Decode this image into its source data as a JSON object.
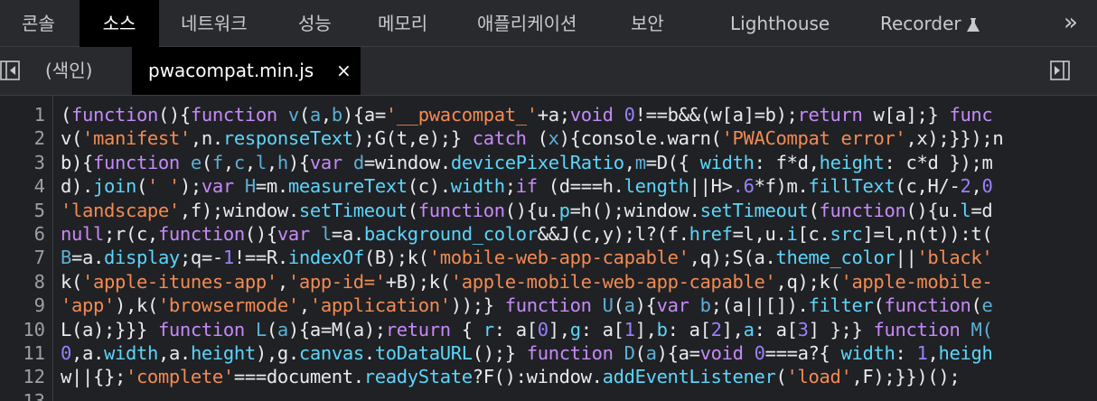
{
  "top_tabs": [
    {
      "label": "콘솔",
      "active": false
    },
    {
      "label": "소스",
      "active": true
    },
    {
      "label": "네트워크",
      "active": false
    },
    {
      "label": "성능",
      "active": false
    },
    {
      "label": "메모리",
      "active": false
    },
    {
      "label": "애플리케이션",
      "active": false
    },
    {
      "label": "보안",
      "active": false
    },
    {
      "label": "Lighthouse",
      "active": false
    },
    {
      "label": "Recorder",
      "active": false
    }
  ],
  "more_label": "»",
  "file_tabs": {
    "index_label": "(색인)",
    "file_label": "pwacompat.min.js",
    "close_label": "×"
  },
  "line_numbers": [
    "1",
    "2",
    "3",
    "4",
    "5",
    "6",
    "7",
    "8",
    "9",
    "10",
    "11",
    "12",
    "13"
  ],
  "code_lines": [
    [
      [
        "p",
        "("
      ],
      [
        "k",
        "function"
      ],
      [
        "p",
        "(){"
      ],
      [
        "k",
        "function"
      ],
      [
        "p",
        " "
      ],
      [
        "v",
        "v"
      ],
      [
        "p",
        "("
      ],
      [
        "v",
        "a"
      ],
      [
        "p",
        ","
      ],
      [
        "v",
        "b"
      ],
      [
        "p",
        "){a="
      ],
      [
        "s",
        "'__pwacompat_'"
      ],
      [
        "p",
        "+a;"
      ],
      [
        "k",
        "void"
      ],
      [
        "p",
        " "
      ],
      [
        "n",
        "0"
      ],
      [
        "p",
        "!==b&&(w[a]=b);"
      ],
      [
        "k",
        "return"
      ],
      [
        "p",
        " w[a];} "
      ],
      [
        "k",
        "func"
      ]
    ],
    [
      [
        "p",
        "v("
      ],
      [
        "s",
        "'manifest'"
      ],
      [
        "p",
        ",n."
      ],
      [
        "c",
        "responseText"
      ],
      [
        "p",
        ");G(t,e);} "
      ],
      [
        "k",
        "catch"
      ],
      [
        "p",
        " ("
      ],
      [
        "v",
        "x"
      ],
      [
        "p",
        "){console.warn("
      ],
      [
        "s",
        "'PWACompat error'"
      ],
      [
        "p",
        ",x);}});n"
      ]
    ],
    [
      [
        "p",
        "b){"
      ],
      [
        "k",
        "function"
      ],
      [
        "p",
        " "
      ],
      [
        "v",
        "e"
      ],
      [
        "p",
        "("
      ],
      [
        "v",
        "f"
      ],
      [
        "p",
        ","
      ],
      [
        "v",
        "c"
      ],
      [
        "p",
        ","
      ],
      [
        "v",
        "l"
      ],
      [
        "p",
        ","
      ],
      [
        "v",
        "h"
      ],
      [
        "p",
        "){"
      ],
      [
        "k",
        "var"
      ],
      [
        "p",
        " "
      ],
      [
        "v",
        "d"
      ],
      [
        "p",
        "=window."
      ],
      [
        "c",
        "devicePixelRatio"
      ],
      [
        "p",
        ","
      ],
      [
        "v",
        "m"
      ],
      [
        "p",
        "=D({ "
      ],
      [
        "c",
        "width"
      ],
      [
        "p",
        ": f*d,"
      ],
      [
        "c",
        "height"
      ],
      [
        "p",
        ": c*d });m"
      ]
    ],
    [
      [
        "p",
        "d)."
      ],
      [
        "c",
        "join"
      ],
      [
        "p",
        "("
      ],
      [
        "s",
        "' '"
      ],
      [
        "p",
        ");"
      ],
      [
        "k",
        "var"
      ],
      [
        "p",
        " "
      ],
      [
        "v",
        "H"
      ],
      [
        "p",
        "=m."
      ],
      [
        "c",
        "measureText"
      ],
      [
        "p",
        "(c)."
      ],
      [
        "c",
        "width"
      ],
      [
        "p",
        ";"
      ],
      [
        "k",
        "if"
      ],
      [
        "p",
        " (d===h."
      ],
      [
        "c",
        "length"
      ],
      [
        "p",
        "||H>"
      ],
      [
        "n",
        ".6"
      ],
      [
        "p",
        "*f)m."
      ],
      [
        "c",
        "fillText"
      ],
      [
        "p",
        "(c,H/-"
      ],
      [
        "n",
        "2"
      ],
      [
        "p",
        ","
      ],
      [
        "n",
        "0"
      ]
    ],
    [
      [
        "s",
        "'landscape'"
      ],
      [
        "p",
        ",f);window."
      ],
      [
        "c",
        "setTimeout"
      ],
      [
        "p",
        "("
      ],
      [
        "k",
        "function"
      ],
      [
        "p",
        "(){u."
      ],
      [
        "c",
        "p"
      ],
      [
        "p",
        "=h();window."
      ],
      [
        "c",
        "setTimeout"
      ],
      [
        "p",
        "("
      ],
      [
        "k",
        "function"
      ],
      [
        "p",
        "(){u."
      ],
      [
        "c",
        "l"
      ],
      [
        "p",
        "=d"
      ]
    ],
    [
      [
        "k",
        "null"
      ],
      [
        "p",
        ";r(c,"
      ],
      [
        "k",
        "function"
      ],
      [
        "p",
        "(){"
      ],
      [
        "k",
        "var"
      ],
      [
        "p",
        " "
      ],
      [
        "v",
        "l"
      ],
      [
        "p",
        "=a."
      ],
      [
        "c",
        "background_color"
      ],
      [
        "p",
        "&&J(c,y);l?(f."
      ],
      [
        "c",
        "href"
      ],
      [
        "p",
        "=l,u."
      ],
      [
        "c",
        "i"
      ],
      [
        "p",
        "[c."
      ],
      [
        "c",
        "src"
      ],
      [
        "p",
        "]=l,n(t)):t("
      ]
    ],
    [
      [
        "v",
        "B"
      ],
      [
        "p",
        "=a."
      ],
      [
        "c",
        "display"
      ],
      [
        "p",
        ";q=-"
      ],
      [
        "n",
        "1"
      ],
      [
        "p",
        "!==R."
      ],
      [
        "c",
        "indexOf"
      ],
      [
        "p",
        "(B);k("
      ],
      [
        "s",
        "'mobile-web-app-capable'"
      ],
      [
        "p",
        ",q);S(a."
      ],
      [
        "c",
        "theme_color"
      ],
      [
        "p",
        "||"
      ],
      [
        "s",
        "'black'"
      ]
    ],
    [
      [
        "p",
        "k("
      ],
      [
        "s",
        "'apple-itunes-app'"
      ],
      [
        "p",
        ","
      ],
      [
        "s",
        "'app-id='"
      ],
      [
        "p",
        "+B);k("
      ],
      [
        "s",
        "'apple-mobile-web-app-capable'"
      ],
      [
        "p",
        ",q);k("
      ],
      [
        "s",
        "'apple-mobile-"
      ]
    ],
    [
      [
        "s",
        "'app'"
      ],
      [
        "p",
        "),k("
      ],
      [
        "s",
        "'browsermode'"
      ],
      [
        "p",
        ","
      ],
      [
        "s",
        "'application'"
      ],
      [
        "p",
        "));} "
      ],
      [
        "k",
        "function"
      ],
      [
        "p",
        " "
      ],
      [
        "v",
        "U"
      ],
      [
        "p",
        "("
      ],
      [
        "v",
        "a"
      ],
      [
        "p",
        "){"
      ],
      [
        "k",
        "var"
      ],
      [
        "p",
        " "
      ],
      [
        "v",
        "b"
      ],
      [
        "p",
        ";(a||[])."
      ],
      [
        "c",
        "filter"
      ],
      [
        "p",
        "("
      ],
      [
        "k",
        "function"
      ],
      [
        "p",
        "("
      ],
      [
        "v",
        "e"
      ]
    ],
    [
      [
        "p",
        "L(a);}}} "
      ],
      [
        "k",
        "function"
      ],
      [
        "p",
        " "
      ],
      [
        "v",
        "L"
      ],
      [
        "p",
        "("
      ],
      [
        "v",
        "a"
      ],
      [
        "p",
        "){a=M(a);"
      ],
      [
        "k",
        "return"
      ],
      [
        "p",
        " { "
      ],
      [
        "c",
        "r"
      ],
      [
        "p",
        ": a["
      ],
      [
        "n",
        "0"
      ],
      [
        "p",
        "],"
      ],
      [
        "c",
        "g"
      ],
      [
        "p",
        ": a["
      ],
      [
        "n",
        "1"
      ],
      [
        "p",
        "],"
      ],
      [
        "c",
        "b"
      ],
      [
        "p",
        ": a["
      ],
      [
        "n",
        "2"
      ],
      [
        "p",
        "],"
      ],
      [
        "c",
        "a"
      ],
      [
        "p",
        ": a["
      ],
      [
        "n",
        "3"
      ],
      [
        "p",
        "] };} "
      ],
      [
        "k",
        "function"
      ],
      [
        "p",
        " "
      ],
      [
        "v",
        "M("
      ]
    ],
    [
      [
        "n",
        "0"
      ],
      [
        "p",
        ",a."
      ],
      [
        "c",
        "width"
      ],
      [
        "p",
        ",a."
      ],
      [
        "c",
        "height"
      ],
      [
        "p",
        "),g."
      ],
      [
        "c",
        "canvas"
      ],
      [
        "p",
        "."
      ],
      [
        "c",
        "toDataURL"
      ],
      [
        "p",
        "();} "
      ],
      [
        "k",
        "function"
      ],
      [
        "p",
        " "
      ],
      [
        "v",
        "D"
      ],
      [
        "p",
        "("
      ],
      [
        "v",
        "a"
      ],
      [
        "p",
        "){a="
      ],
      [
        "k",
        "void"
      ],
      [
        "p",
        " "
      ],
      [
        "n",
        "0"
      ],
      [
        "p",
        "===a?{ "
      ],
      [
        "c",
        "width"
      ],
      [
        "p",
        ": "
      ],
      [
        "n",
        "1"
      ],
      [
        "p",
        ","
      ],
      [
        "c",
        "heigh"
      ]
    ],
    [
      [
        "p",
        "w||{};"
      ],
      [
        "s",
        "'complete'"
      ],
      [
        "p",
        "===document."
      ],
      [
        "c",
        "readyState"
      ],
      [
        "p",
        "?F():window."
      ],
      [
        "c",
        "addEventListener"
      ],
      [
        "p",
        "("
      ],
      [
        "s",
        "'load'"
      ],
      [
        "p",
        ",F);}})();"
      ]
    ],
    []
  ]
}
